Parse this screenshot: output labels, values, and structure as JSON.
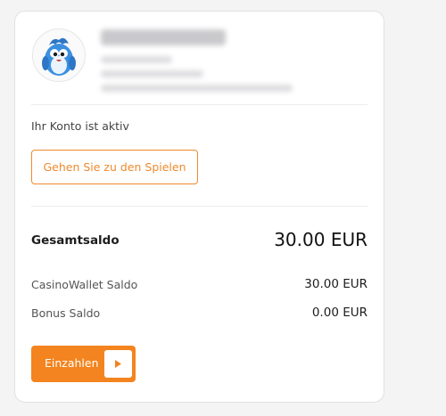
{
  "account": {
    "status_text": "Ihr Konto ist aktiv",
    "games_button_label": "Gehen Sie zu den Spielen"
  },
  "balance": {
    "total_label": "Gesamtsaldo",
    "total_value": "30.00 EUR",
    "rows": [
      {
        "label": "CasinoWallet Saldo",
        "value": "30.00 EUR"
      },
      {
        "label": "Bonus Saldo",
        "value": "0.00 EUR"
      }
    ]
  },
  "deposit": {
    "button_label": "Einzahlen",
    "icon": "play-icon"
  },
  "avatar": {
    "icon": "bird-mascot-avatar"
  },
  "colors": {
    "accent": "#f3841f",
    "accent_outline": "#ef8a2e",
    "card_background": "#ffffff",
    "page_background": "#f4f4f5"
  }
}
